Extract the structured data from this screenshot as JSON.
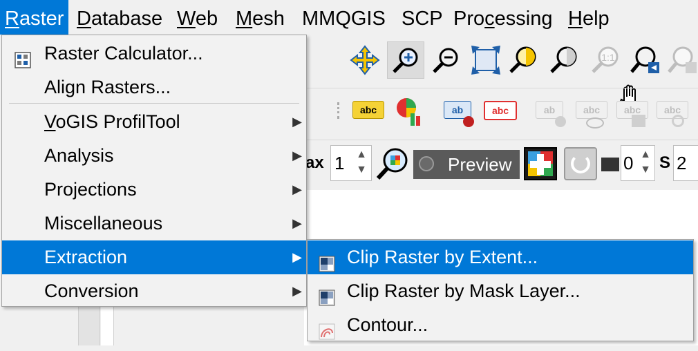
{
  "menubar": {
    "items": [
      {
        "label": "Raster",
        "key": "R",
        "rest": "aster"
      },
      {
        "label": "Database",
        "key": "D",
        "rest": "atabase"
      },
      {
        "label": "Web",
        "key": "W",
        "rest": "eb"
      },
      {
        "label": "Mesh",
        "key": "M",
        "rest": "esh"
      },
      {
        "label": "MMQGIS"
      },
      {
        "label": "SCP"
      },
      {
        "label": "Processing",
        "pre": "Pro",
        "key": "c",
        "rest": "essing"
      },
      {
        "label": "Help",
        "key": "H",
        "rest": "elp"
      }
    ]
  },
  "raster_menu": {
    "items": [
      {
        "label": "Raster Calculator...",
        "icon": "raster-calculator-icon"
      },
      {
        "label": "Align Rasters..."
      },
      {
        "label": "VoGIS ProfilTool",
        "key": "V",
        "rest": "oGIS ProfilTool",
        "submenu": true
      },
      {
        "label": "Analysis",
        "submenu": true
      },
      {
        "label": "Projections",
        "submenu": true
      },
      {
        "label": "Miscellaneous",
        "submenu": true
      },
      {
        "label": "Extraction",
        "submenu": true,
        "highlighted": true
      },
      {
        "label": "Conversion",
        "submenu": true
      }
    ],
    "arrow_glyph": "▶"
  },
  "extraction_submenu": {
    "items": [
      {
        "label": "Clip Raster by Extent...",
        "icon": "clip-extent-icon",
        "highlighted": true
      },
      {
        "label": "Clip Raster by Mask Layer...",
        "icon": "clip-mask-icon"
      },
      {
        "label": "Contour...",
        "icon": "contour-icon"
      }
    ]
  },
  "toolbar": {
    "preview_label": "Preview",
    "spin1_value": "1",
    "spin2_value": "0",
    "spin3_value": "2",
    "label_fragment_1": "ax",
    "label_fragment_2": "S",
    "abc": "abc",
    "ab": "ab"
  },
  "colors": {
    "highlight": "#0078d7",
    "menu_bg": "#f2f2f2",
    "label_yellow": "#f5d236",
    "label_red": "#e03030"
  }
}
